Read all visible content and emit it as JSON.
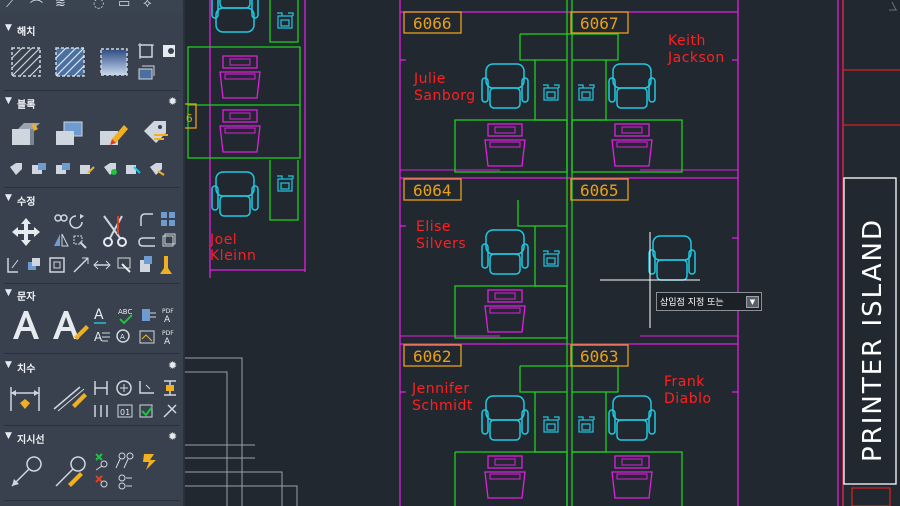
{
  "palette": {
    "sections": [
      {
        "id": "hatch",
        "title": "해치"
      },
      {
        "id": "block",
        "title": "블록"
      },
      {
        "id": "modify",
        "title": "수정"
      },
      {
        "id": "text",
        "title": "문자"
      },
      {
        "id": "dimension",
        "title": "치수"
      },
      {
        "id": "leader",
        "title": "지시선"
      }
    ],
    "icons": {
      "section_toggle": "triangle-down",
      "section_settings": "gear"
    }
  },
  "drawing": {
    "rooms": [
      "6066",
      "6067",
      "6064",
      "6065",
      "6062",
      "6063"
    ],
    "people": {
      "keith": [
        "Keith",
        "Jackson"
      ],
      "julie": [
        "Julie",
        "Sanborg"
      ],
      "elise": [
        "Elise",
        "Silvers"
      ],
      "joel": [
        "Joel",
        "Kleinn"
      ],
      "jennifer": [
        "Jennifer",
        "Schmidt"
      ],
      "frank": [
        "Frank",
        "Diablo"
      ]
    },
    "island_label": "PRINTER ISLAND",
    "colors": {
      "background": "#212830",
      "wall": "#e020e0",
      "desk": "#20d020",
      "chair": "#20c8e0",
      "room_number": "#e8a01a",
      "person_name": "#ff2020",
      "outline": "#ff2020"
    }
  },
  "cursor_tooltip": {
    "prompt": "삽입점 지정 또는",
    "dropdown_icon": "chevron-down"
  }
}
